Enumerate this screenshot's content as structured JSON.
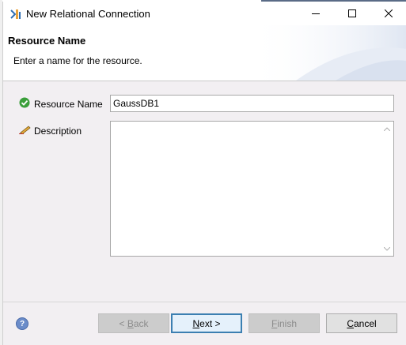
{
  "window": {
    "title": "New Relational Connection",
    "controls": {
      "minimize_icon": "minimize-icon",
      "maximize_icon": "maximize-icon",
      "close_icon": "close-icon"
    }
  },
  "header": {
    "title": "Resource Name",
    "description": "Enter a name for the resource."
  },
  "form": {
    "resource_name": {
      "label": "Resource Name",
      "value": "GaussDB1",
      "status_icon": "check-circle-icon"
    },
    "description": {
      "label": "Description",
      "value": "",
      "icon": "pencil-icon"
    }
  },
  "footer": {
    "help_icon": "help-icon",
    "buttons": {
      "back": {
        "label": "< Back",
        "mnemonic": "B",
        "enabled": false
      },
      "next": {
        "label": "Next >",
        "mnemonic": "N",
        "enabled": true
      },
      "finish": {
        "label": "Finish",
        "mnemonic": "F",
        "enabled": false
      },
      "cancel": {
        "label": "Cancel",
        "mnemonic": "C",
        "enabled": true
      }
    }
  },
  "colors": {
    "body_bg": "#f2eff2",
    "default_button_border": "#3c7fb1",
    "check_green": "#3a9e3a"
  }
}
